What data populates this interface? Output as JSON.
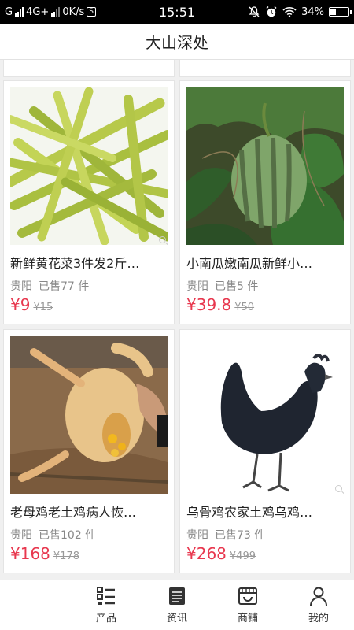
{
  "status_bar": {
    "carrier": "G",
    "network": "4G+",
    "speed": "0K/s",
    "speed_badge": "S",
    "time": "15:51",
    "battery": "34%",
    "battery_level": 0.34
  },
  "header": {
    "title": "大山深处"
  },
  "products": [
    {
      "title": "新鲜黄花菜3件发2斤…",
      "location": "贵阳",
      "sold": "已售77 件",
      "price": "¥9",
      "old_price": "¥15",
      "image": "daylily-image"
    },
    {
      "title": "小南瓜嫩南瓜新鲜小…",
      "location": "贵阳",
      "sold": "已售5 件",
      "price": "¥39.8",
      "old_price": "¥50",
      "image": "pumpkin-image"
    },
    {
      "title": "老母鸡老土鸡病人恢…",
      "location": "贵阳",
      "sold": "已售102 件",
      "price": "¥168",
      "old_price": "¥178",
      "image": "chicken-image"
    },
    {
      "title": "乌骨鸡农家土鸡乌鸡…",
      "location": "贵阳",
      "sold": "已售73 件",
      "price": "¥268",
      "old_price": "¥499",
      "image": "black-chicken-image"
    }
  ],
  "tabs": [
    {
      "label": "产品",
      "icon": "list-icon"
    },
    {
      "label": "资讯",
      "icon": "news-icon"
    },
    {
      "label": "商铺",
      "icon": "shop-icon"
    },
    {
      "label": "我的",
      "icon": "user-icon"
    }
  ],
  "colors": {
    "price": "#e8384f",
    "accent": "#222222"
  }
}
